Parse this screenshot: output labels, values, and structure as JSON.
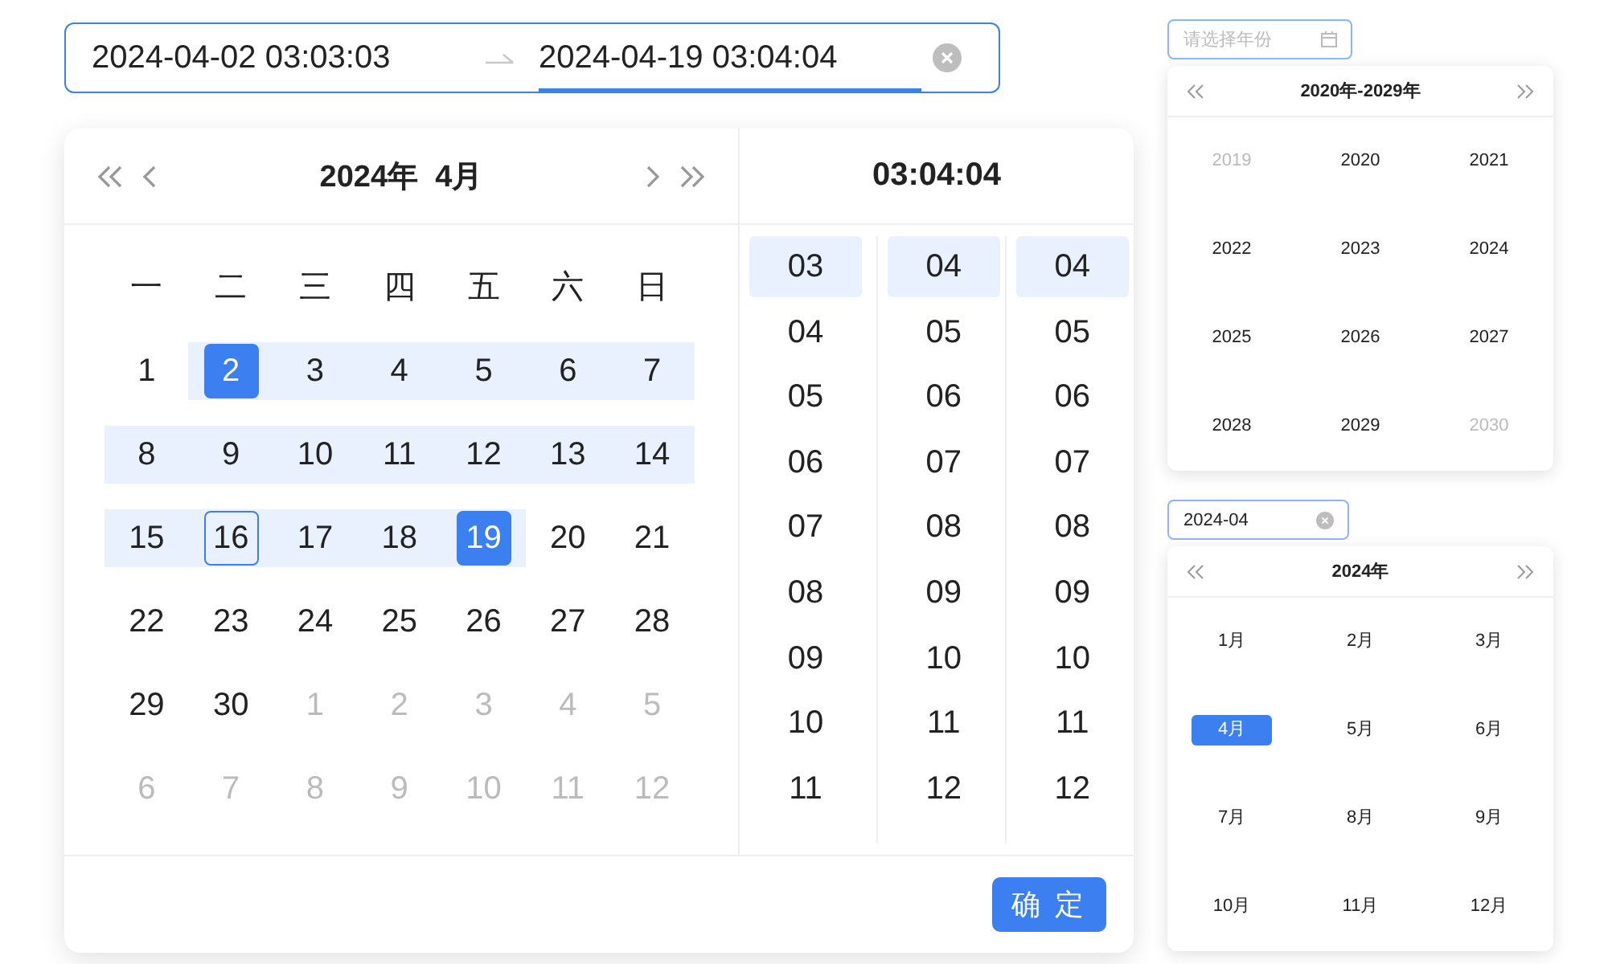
{
  "range_input": {
    "start": "2024-04-02 03:03:03",
    "end": "2024-04-19 03:04:04",
    "active_end": true
  },
  "date_panel": {
    "title": "2024年  4月",
    "weekdays": [
      "一",
      "二",
      "三",
      "四",
      "五",
      "六",
      "日"
    ],
    "days": [
      {
        "label": "1",
        "outside": false,
        "in_range": false,
        "selected": false,
        "today": false
      },
      {
        "label": "2",
        "outside": false,
        "in_range": true,
        "selected": true,
        "today": false
      },
      {
        "label": "3",
        "outside": false,
        "in_range": true,
        "selected": false,
        "today": false
      },
      {
        "label": "4",
        "outside": false,
        "in_range": true,
        "selected": false,
        "today": false
      },
      {
        "label": "5",
        "outside": false,
        "in_range": true,
        "selected": false,
        "today": false
      },
      {
        "label": "6",
        "outside": false,
        "in_range": true,
        "selected": false,
        "today": false
      },
      {
        "label": "7",
        "outside": false,
        "in_range": true,
        "selected": false,
        "today": false
      },
      {
        "label": "8",
        "outside": false,
        "in_range": true,
        "selected": false,
        "today": false
      },
      {
        "label": "9",
        "outside": false,
        "in_range": true,
        "selected": false,
        "today": false
      },
      {
        "label": "10",
        "outside": false,
        "in_range": true,
        "selected": false,
        "today": false
      },
      {
        "label": "11",
        "outside": false,
        "in_range": true,
        "selected": false,
        "today": false
      },
      {
        "label": "12",
        "outside": false,
        "in_range": true,
        "selected": false,
        "today": false
      },
      {
        "label": "13",
        "outside": false,
        "in_range": true,
        "selected": false,
        "today": false
      },
      {
        "label": "14",
        "outside": false,
        "in_range": true,
        "selected": false,
        "today": false
      },
      {
        "label": "15",
        "outside": false,
        "in_range": true,
        "selected": false,
        "today": false
      },
      {
        "label": "16",
        "outside": false,
        "in_range": true,
        "selected": false,
        "today": true
      },
      {
        "label": "17",
        "outside": false,
        "in_range": true,
        "selected": false,
        "today": false
      },
      {
        "label": "18",
        "outside": false,
        "in_range": true,
        "selected": false,
        "today": false
      },
      {
        "label": "19",
        "outside": false,
        "in_range": true,
        "selected": true,
        "today": false
      },
      {
        "label": "20",
        "outside": false,
        "in_range": false,
        "selected": false,
        "today": false
      },
      {
        "label": "21",
        "outside": false,
        "in_range": false,
        "selected": false,
        "today": false
      },
      {
        "label": "22",
        "outside": false,
        "in_range": false,
        "selected": false,
        "today": false
      },
      {
        "label": "23",
        "outside": false,
        "in_range": false,
        "selected": false,
        "today": false
      },
      {
        "label": "24",
        "outside": false,
        "in_range": false,
        "selected": false,
        "today": false
      },
      {
        "label": "25",
        "outside": false,
        "in_range": false,
        "selected": false,
        "today": false
      },
      {
        "label": "26",
        "outside": false,
        "in_range": false,
        "selected": false,
        "today": false
      },
      {
        "label": "27",
        "outside": false,
        "in_range": false,
        "selected": false,
        "today": false
      },
      {
        "label": "28",
        "outside": false,
        "in_range": false,
        "selected": false,
        "today": false
      },
      {
        "label": "29",
        "outside": false,
        "in_range": false,
        "selected": false,
        "today": false
      },
      {
        "label": "30",
        "outside": false,
        "in_range": false,
        "selected": false,
        "today": false
      },
      {
        "label": "1",
        "outside": true,
        "in_range": false,
        "selected": false,
        "today": false
      },
      {
        "label": "2",
        "outside": true,
        "in_range": false,
        "selected": false,
        "today": false
      },
      {
        "label": "3",
        "outside": true,
        "in_range": false,
        "selected": false,
        "today": false
      },
      {
        "label": "4",
        "outside": true,
        "in_range": false,
        "selected": false,
        "today": false
      },
      {
        "label": "5",
        "outside": true,
        "in_range": false,
        "selected": false,
        "today": false
      },
      {
        "label": "6",
        "outside": true,
        "in_range": false,
        "selected": false,
        "today": false
      },
      {
        "label": "7",
        "outside": true,
        "in_range": false,
        "selected": false,
        "today": false
      },
      {
        "label": "8",
        "outside": true,
        "in_range": false,
        "selected": false,
        "today": false
      },
      {
        "label": "9",
        "outside": true,
        "in_range": false,
        "selected": false,
        "today": false
      },
      {
        "label": "10",
        "outside": true,
        "in_range": false,
        "selected": false,
        "today": false
      },
      {
        "label": "11",
        "outside": true,
        "in_range": false,
        "selected": false,
        "today": false
      },
      {
        "label": "12",
        "outside": true,
        "in_range": false,
        "selected": false,
        "today": false
      }
    ]
  },
  "time_panel": {
    "title": "03:04:04",
    "columns": [
      [
        {
          "label": "03",
          "selected": true
        },
        {
          "label": "04",
          "selected": false
        },
        {
          "label": "05",
          "selected": false
        },
        {
          "label": "06",
          "selected": false
        },
        {
          "label": "07",
          "selected": false
        },
        {
          "label": "08",
          "selected": false
        },
        {
          "label": "09",
          "selected": false
        },
        {
          "label": "10",
          "selected": false
        },
        {
          "label": "11",
          "selected": false
        }
      ],
      [
        {
          "label": "04",
          "selected": true
        },
        {
          "label": "05",
          "selected": false
        },
        {
          "label": "06",
          "selected": false
        },
        {
          "label": "07",
          "selected": false
        },
        {
          "label": "08",
          "selected": false
        },
        {
          "label": "09",
          "selected": false
        },
        {
          "label": "10",
          "selected": false
        },
        {
          "label": "11",
          "selected": false
        },
        {
          "label": "12",
          "selected": false
        }
      ],
      [
        {
          "label": "04",
          "selected": true
        },
        {
          "label": "05",
          "selected": false
        },
        {
          "label": "06",
          "selected": false
        },
        {
          "label": "07",
          "selected": false
        },
        {
          "label": "08",
          "selected": false
        },
        {
          "label": "09",
          "selected": false
        },
        {
          "label": "10",
          "selected": false
        },
        {
          "label": "11",
          "selected": false
        },
        {
          "label": "12",
          "selected": false
        }
      ]
    ]
  },
  "confirm_button": "确 定",
  "year_picker": {
    "placeholder": "请选择年份",
    "title": "2020年-2029年",
    "years": [
      {
        "label": "2019",
        "outside": true,
        "selected": false
      },
      {
        "label": "2020",
        "outside": false,
        "selected": false
      },
      {
        "label": "2021",
        "outside": false,
        "selected": false
      },
      {
        "label": "2022",
        "outside": false,
        "selected": false
      },
      {
        "label": "2023",
        "outside": false,
        "selected": false
      },
      {
        "label": "2024",
        "outside": false,
        "selected": false
      },
      {
        "label": "2025",
        "outside": false,
        "selected": false
      },
      {
        "label": "2026",
        "outside": false,
        "selected": false
      },
      {
        "label": "2027",
        "outside": false,
        "selected": false
      },
      {
        "label": "2028",
        "outside": false,
        "selected": false
      },
      {
        "label": "2029",
        "outside": false,
        "selected": false
      },
      {
        "label": "2030",
        "outside": true,
        "selected": false
      }
    ]
  },
  "month_picker": {
    "value": "2024-04",
    "title": "2024年",
    "months": [
      {
        "label": "1月",
        "selected": false
      },
      {
        "label": "2月",
        "selected": false
      },
      {
        "label": "3月",
        "selected": false
      },
      {
        "label": "4月",
        "selected": true
      },
      {
        "label": "5月",
        "selected": false
      },
      {
        "label": "6月",
        "selected": false
      },
      {
        "label": "7月",
        "selected": false
      },
      {
        "label": "8月",
        "selected": false
      },
      {
        "label": "9月",
        "selected": false
      },
      {
        "label": "10月",
        "selected": false
      },
      {
        "label": "11月",
        "selected": false
      },
      {
        "label": "12月",
        "selected": false
      }
    ]
  }
}
